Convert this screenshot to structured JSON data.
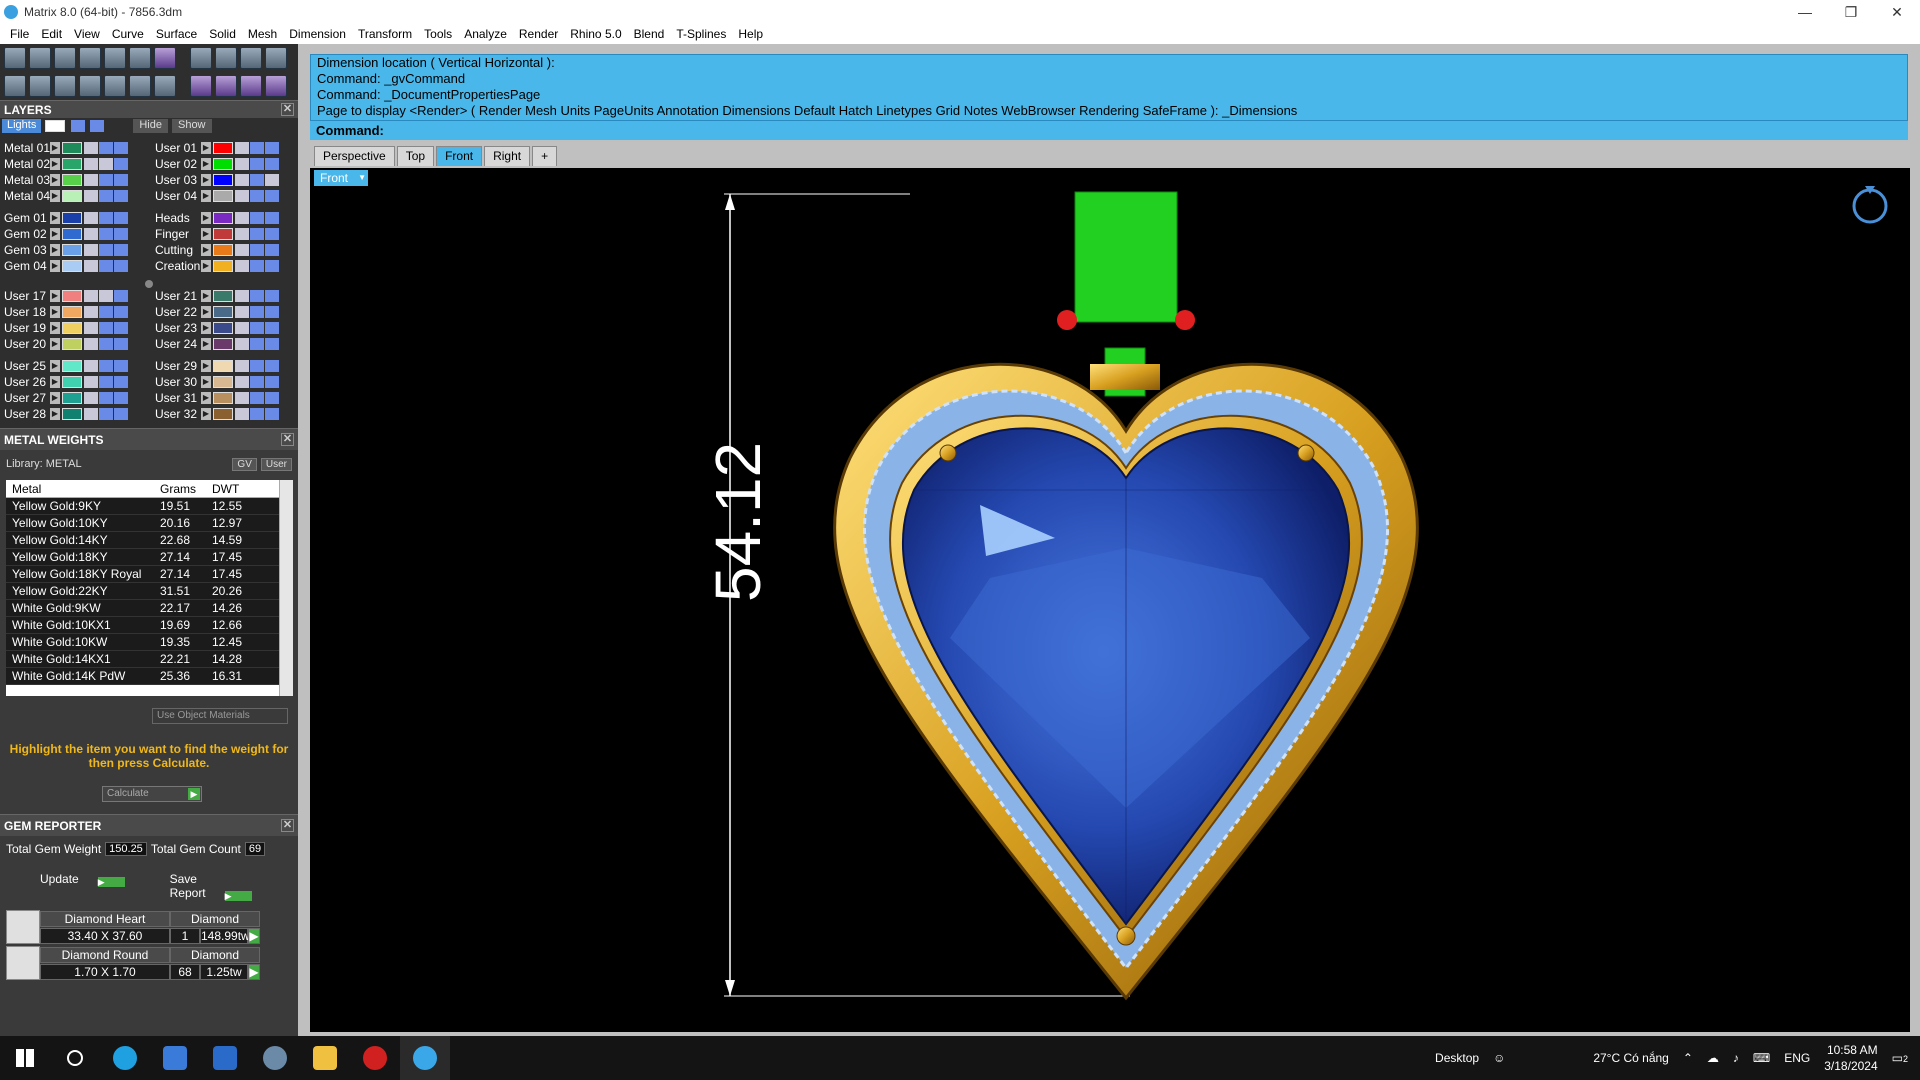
{
  "window": {
    "title": "Matrix 8.0 (64-bit) - 7856.3dm",
    "minimize": "—",
    "maximize": "❐",
    "close": "✕"
  },
  "menu": [
    "File",
    "Edit",
    "View",
    "Curve",
    "Surface",
    "Solid",
    "Mesh",
    "Dimension",
    "Transform",
    "Tools",
    "Analyze",
    "Render",
    "Rhino 5.0",
    "Blend",
    "T-Splines",
    "Help"
  ],
  "layers": {
    "title": "LAYERS",
    "lights": "Lights",
    "hide": "Hide",
    "show": "Show",
    "groups": [
      {
        "left": [
          {
            "name": "Metal 01",
            "color": "#1f8a5a"
          },
          {
            "name": "Metal 02",
            "color": "#2aa56a"
          },
          {
            "name": "Metal 03",
            "color": "#59d04a"
          },
          {
            "name": "Metal 04",
            "color": "#b8f0b8"
          }
        ],
        "right": [
          {
            "name": "User 01",
            "color": "#ff0000"
          },
          {
            "name": "User 02",
            "color": "#00dd00"
          },
          {
            "name": "User 03",
            "color": "#0000ff"
          },
          {
            "name": "User 04",
            "color": "#aaaaaa"
          }
        ]
      },
      {
        "left": [
          {
            "name": "Gem 01",
            "color": "#1b3fa8"
          },
          {
            "name": "Gem 02",
            "color": "#2f6ad0"
          },
          {
            "name": "Gem 03",
            "color": "#6aa0e8"
          },
          {
            "name": "Gem 04",
            "color": "#a8ccf4"
          }
        ],
        "right": [
          {
            "name": "Heads",
            "color": "#7a2ac0"
          },
          {
            "name": "Finger",
            "color": "#c03a3a"
          },
          {
            "name": "Cutting",
            "color": "#e87a1a"
          },
          {
            "name": "Creation",
            "color": "#f0b020"
          }
        ]
      },
      {
        "left": [
          {
            "name": "User 17",
            "color": "#f08080"
          },
          {
            "name": "User 18",
            "color": "#f0a860"
          },
          {
            "name": "User 19",
            "color": "#f0d060"
          },
          {
            "name": "User 20",
            "color": "#c0d060"
          }
        ],
        "right": [
          {
            "name": "User 21",
            "color": "#3a7a6a"
          },
          {
            "name": "User 22",
            "color": "#4a6a8a"
          },
          {
            "name": "User 23",
            "color": "#3a4a8a"
          },
          {
            "name": "User 24",
            "color": "#6a3a6a"
          }
        ]
      },
      {
        "left": [
          {
            "name": "User 25",
            "color": "#60e8c8"
          },
          {
            "name": "User 26",
            "color": "#40d0b0"
          },
          {
            "name": "User 27",
            "color": "#20a090"
          },
          {
            "name": "User 28",
            "color": "#108070"
          }
        ],
        "right": [
          {
            "name": "User 29",
            "color": "#f0d8b0"
          },
          {
            "name": "User 30",
            "color": "#d8b890"
          },
          {
            "name": "User 31",
            "color": "#b89060"
          },
          {
            "name": "User 32",
            "color": "#8a6030"
          }
        ]
      }
    ]
  },
  "metal_weights": {
    "title": "METAL WEIGHTS",
    "library": "Library: METAL",
    "gv": "GV",
    "user": "User",
    "cols": [
      "Metal",
      "Grams",
      "DWT"
    ],
    "rows": [
      [
        "Yellow Gold:9KY",
        "19.51",
        "12.55"
      ],
      [
        "Yellow Gold:10KY",
        "20.16",
        "12.97"
      ],
      [
        "Yellow Gold:14KY",
        "22.68",
        "14.59"
      ],
      [
        "Yellow Gold:18KY",
        "27.14",
        "17.45"
      ],
      [
        "Yellow Gold:18KY Royal",
        "27.14",
        "17.45"
      ],
      [
        "Yellow Gold:22KY",
        "31.51",
        "20.26"
      ],
      [
        "White Gold:9KW",
        "22.17",
        "14.26"
      ],
      [
        "White Gold:10KX1",
        "19.69",
        "12.66"
      ],
      [
        "White Gold:10KW",
        "19.35",
        "12.45"
      ],
      [
        "White Gold:14KX1",
        "22.21",
        "14.28"
      ],
      [
        "White Gold:14K PdW",
        "25.36",
        "16.31"
      ]
    ],
    "use_object": "Use Object Materials",
    "note": "Highlight the item you want to find the weight for then press Calculate.",
    "calculate": "Calculate"
  },
  "gem_reporter": {
    "title": "GEM REPORTER",
    "total_weight_label": "Total Gem Weight",
    "total_weight": "150.25",
    "total_count_label": "Total Gem Count",
    "total_count": "69",
    "update": "Update",
    "save_report": "Save Report",
    "gems": [
      {
        "shape": "Diamond Heart",
        "material": "Diamond",
        "size": "33.40 X 37.60",
        "count": "1",
        "weight": "148.99tw"
      },
      {
        "shape": "Diamond Round",
        "material": "Diamond",
        "size": "1.70 X 1.70",
        "count": "68",
        "weight": "1.25tw"
      }
    ]
  },
  "command": {
    "history": [
      "Dimension location ( Vertical  Horizontal ):",
      "Command: _gvCommand",
      "Command: _DocumentPropertiesPage",
      "Page to display <Render> ( Render  Mesh  Units  PageUnits  Annotation  Dimensions  Default  Hatch  Linetypes  Grid  Notes  WebBrowser  Rendering  SafeFrame ): _Dimensions"
    ],
    "prompt": "Command:"
  },
  "viewport_tabs": [
    "Perspective",
    "Top",
    "Front",
    "Right"
  ],
  "active_tab": "Front",
  "viewport_label": "Front",
  "dimension_text": "54.12",
  "taskbar": {
    "desktop": "Desktop",
    "weather": "27°C  Có nắng",
    "lang": "ENG",
    "time": "10:58 AM",
    "date": "3/18/2024",
    "notif": "2"
  }
}
